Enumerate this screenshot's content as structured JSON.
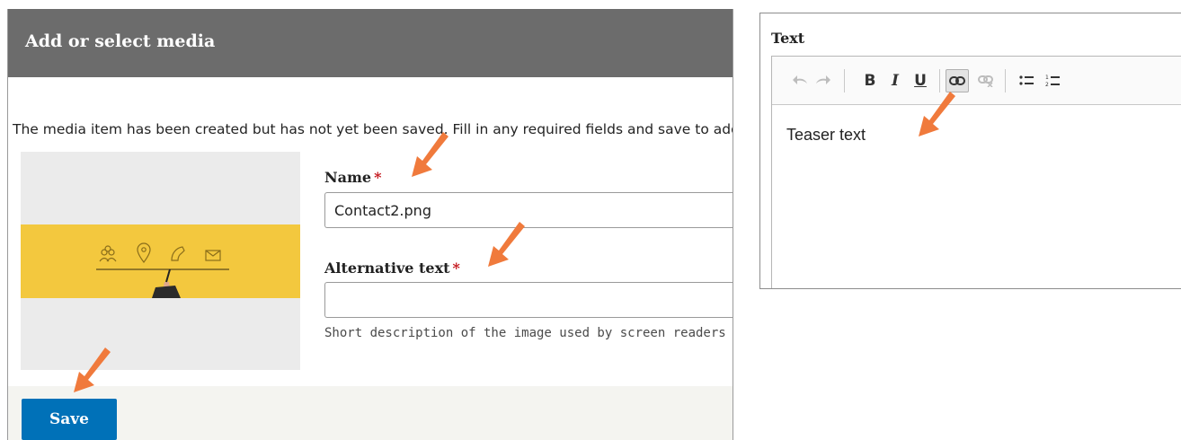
{
  "dialog": {
    "title": "Add or select media",
    "message": "The media item has been created but has not yet been saved. Fill in any required fields and save to add it to the media library.",
    "preview": {
      "icons": [
        "users-icon",
        "map-pin-icon",
        "phone-icon",
        "mail-icon"
      ]
    },
    "fields": {
      "name": {
        "label": "Name",
        "required_marker": "*",
        "value": "Contact2.png"
      },
      "alt_text": {
        "label": "Alternative text",
        "required_marker": "*",
        "value": "",
        "description": "Short description of the image used by screen readers and displayed when the image is not loaded."
      }
    },
    "save_label": "Save"
  },
  "editor": {
    "label": "Text",
    "toolbar": [
      {
        "icon": "undo-icon",
        "state": "disabled"
      },
      {
        "icon": "redo-icon",
        "state": "disabled"
      },
      {
        "icon": "bold-icon",
        "text": "B",
        "state": "enabled"
      },
      {
        "icon": "italic-icon",
        "text": "I",
        "state": "enabled"
      },
      {
        "icon": "underline-icon",
        "text": "U",
        "state": "enabled"
      },
      {
        "icon": "link-icon",
        "state": "active"
      },
      {
        "icon": "unlink-icon",
        "state": "disabled"
      },
      {
        "icon": "bulleted-list-icon",
        "state": "enabled"
      },
      {
        "icon": "numbered-list-icon",
        "state": "enabled"
      }
    ],
    "content": "Teaser text"
  },
  "colors": {
    "titlebar": "#6c6c6c",
    "primary_button": "#0071b8",
    "required_marker": "#c4161c",
    "annotation_arrow": "#f07a3c",
    "preview_band": "#f3c83e"
  }
}
